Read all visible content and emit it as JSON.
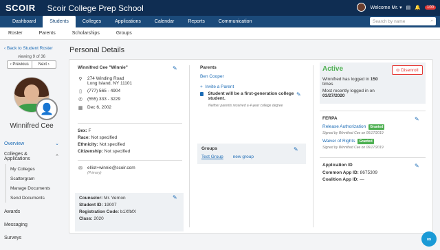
{
  "header": {
    "logo": "SCOIR",
    "school": "Scoir College Prep School",
    "welcome": "Welcome Mr.",
    "notif_count": "100"
  },
  "nav": {
    "tabs": [
      "Dashboard",
      "Students",
      "Colleges",
      "Applications",
      "Calendar",
      "Reports",
      "Communication"
    ],
    "active": "Students",
    "search_placeholder": "Search by name"
  },
  "subnav": [
    "Roster",
    "Parents",
    "Scholarships",
    "Groups"
  ],
  "sidebar": {
    "back": "Back to Student Roster",
    "viewing": "viewing 9 of 36",
    "prev": "Previous",
    "next": "Next",
    "student_name": "Winnifred Cee",
    "overview": "Overview",
    "colleges_apps": "Colleges & Applications",
    "colleges_sub": [
      "My Colleges",
      "Scattergram",
      "Manage Documents",
      "Send Documents"
    ],
    "awards": "Awards",
    "messaging": "Messaging",
    "surveys": "Surveys"
  },
  "main": {
    "title": "Personal Details",
    "student": {
      "name": "Winnifred Cee \"Winnie\"",
      "address1": "274 Winding Road",
      "address2": "Long Island, NY 11101",
      "mobile": "(777) 565 - 4904",
      "phone": "(555) 333 - 3229",
      "dob": "Dec 6, 2002",
      "sex_label": "Sex:",
      "sex": "F",
      "race_label": "Race:",
      "race": "Not specified",
      "eth_label": "Ethnicity:",
      "eth": "Not specified",
      "cit_label": "Citizenship:",
      "cit": "Not specified",
      "email": "elliot+winnie@scoir.com",
      "email_type": "(Primary)",
      "counselor_label": "Counselor:",
      "counselor": "Mr. Vernon",
      "sid_label": "Student ID:",
      "sid": "19007",
      "reg_label": "Registration Code:",
      "reg": "b1XfbfX",
      "class_label": "Class:",
      "class": "2020"
    },
    "parents": {
      "title": "Parents",
      "parent1": "Ben Cooper",
      "invite": "Invite a Parent",
      "first_gen": "Student will be a first-generation college student.",
      "first_gen_note": "Neither parents received a 4-year college degree"
    },
    "groups": {
      "title": "Groups",
      "group1": "Test Group",
      "new_group": "new group"
    },
    "status": {
      "active": "Active",
      "disenroll": "Disenroll",
      "logins_pre": "Winnifred has logged in",
      "logins_count": "150",
      "logins_post": "times",
      "recent": "Most recently logged in on",
      "recent_date": "03/27/2020"
    },
    "ferpa": {
      "title": "FERPA",
      "item1": "Release Authorization",
      "item1_badge": "Granted",
      "item1_signed": "Signed by Winnifred Cee on 06/17/2019",
      "item2": "Waiver of Rights",
      "item2_badge": "Granted",
      "item2_signed": "Signed by Winnifred Cee on 06/17/2019"
    },
    "appid": {
      "title": "Application ID",
      "common_label": "Common App ID:",
      "common": "8675309",
      "coalition_label": "Coalition App ID:",
      "coalition": "—"
    }
  },
  "colors": {
    "navy": "#0f2d52",
    "nav_blue": "#1b4a7a",
    "link": "#1b6bb5",
    "active_green": "#4caf50",
    "danger": "#e53935"
  },
  "icons": [
    "chat-icon",
    "bell-icon",
    "search-icon",
    "pencil-icon",
    "location-icon",
    "mobile-icon",
    "phone-icon",
    "calendar-icon",
    "email-icon",
    "plus-icon",
    "checkbox-icon",
    "chevron-down-icon",
    "chevron-up-icon",
    "chevron-left-icon",
    "chevron-right-icon"
  ]
}
